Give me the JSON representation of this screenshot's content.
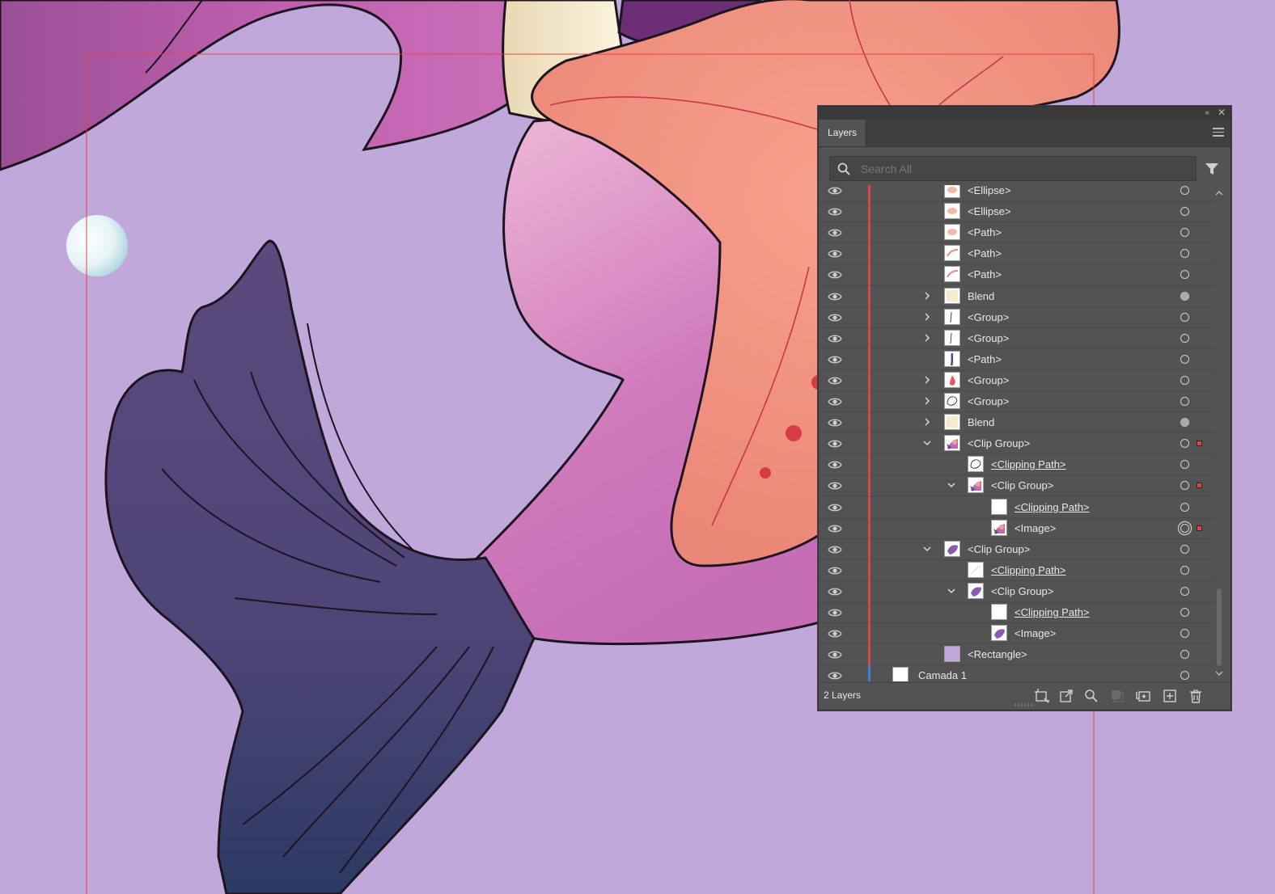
{
  "panel": {
    "title": "Layers",
    "collapse_glyph": "«",
    "close_glyph": "✕",
    "search_placeholder": "Search All",
    "layer_count": "2 Layers"
  },
  "colors": {
    "canvas_background": "#c0a9da",
    "panel_background": "#535353",
    "layer_color_red": "#e0424a",
    "layer_color_blue": "#3f7fe0"
  },
  "rows": [
    {
      "name": "<Ellipse>",
      "depth": 2,
      "chevron": "none",
      "thumb": "ellipse",
      "target": "empty",
      "selected": false,
      "bar": "red",
      "clip": false
    },
    {
      "name": "<Ellipse>",
      "depth": 2,
      "chevron": "none",
      "thumb": "ellipse",
      "target": "empty",
      "selected": false,
      "bar": "red",
      "clip": false
    },
    {
      "name": "<Path>",
      "depth": 2,
      "chevron": "none",
      "thumb": "ellipse",
      "target": "empty",
      "selected": false,
      "bar": "red",
      "clip": false
    },
    {
      "name": "<Path>",
      "depth": 2,
      "chevron": "none",
      "thumb": "stroke",
      "target": "empty",
      "selected": false,
      "bar": "red",
      "clip": false
    },
    {
      "name": "<Path>",
      "depth": 2,
      "chevron": "none",
      "thumb": "stroke",
      "target": "empty",
      "selected": false,
      "bar": "red",
      "clip": false
    },
    {
      "name": "Blend",
      "depth": 2,
      "chevron": "right",
      "thumb": "cream",
      "target": "filled",
      "selected": false,
      "bar": "red",
      "clip": false
    },
    {
      "name": "<Group>",
      "depth": 2,
      "chevron": "right",
      "thumb": "line",
      "target": "empty",
      "selected": false,
      "bar": "red",
      "clip": false
    },
    {
      "name": "<Group>",
      "depth": 2,
      "chevron": "right",
      "thumb": "line",
      "target": "empty",
      "selected": false,
      "bar": "red",
      "clip": false
    },
    {
      "name": "<Path>",
      "depth": 2,
      "chevron": "none",
      "thumb": "purple-line",
      "target": "empty",
      "selected": false,
      "bar": "red",
      "clip": false
    },
    {
      "name": "<Group>",
      "depth": 2,
      "chevron": "right",
      "thumb": "drop",
      "target": "empty",
      "selected": false,
      "bar": "red",
      "clip": false
    },
    {
      "name": "<Group>",
      "depth": 2,
      "chevron": "right",
      "thumb": "outline",
      "target": "empty",
      "selected": false,
      "bar": "red",
      "clip": false
    },
    {
      "name": "Blend",
      "depth": 2,
      "chevron": "right",
      "thumb": "cream",
      "target": "filled",
      "selected": false,
      "bar": "red",
      "clip": false
    },
    {
      "name": "<Clip Group>",
      "depth": 2,
      "chevron": "down",
      "thumb": "art",
      "target": "empty",
      "selected": true,
      "bar": "red",
      "clip": false
    },
    {
      "name": "<Clipping Path>",
      "depth": 3,
      "chevron": "none",
      "thumb": "outline",
      "target": "empty",
      "selected": false,
      "bar": "red",
      "clip": true
    },
    {
      "name": "<Clip Group>",
      "depth": 3,
      "chevron": "down",
      "thumb": "art",
      "target": "empty",
      "selected": true,
      "bar": "red",
      "clip": false
    },
    {
      "name": "<Clipping Path>",
      "depth": 4,
      "chevron": "none",
      "thumb": "blank",
      "target": "empty",
      "selected": false,
      "bar": "red",
      "clip": true
    },
    {
      "name": "<Image>",
      "depth": 4,
      "chevron": "none",
      "thumb": "art",
      "target": "double",
      "selected": true,
      "bar": "red",
      "clip": false
    },
    {
      "name": "<Clip Group>",
      "depth": 2,
      "chevron": "down",
      "thumb": "tail",
      "target": "empty",
      "selected": false,
      "bar": "red",
      "clip": false
    },
    {
      "name": "<Clipping Path>",
      "depth": 3,
      "chevron": "none",
      "thumb": "blank-line",
      "target": "empty",
      "selected": false,
      "bar": "red",
      "clip": true
    },
    {
      "name": "<Clip Group>",
      "depth": 3,
      "chevron": "down",
      "thumb": "tail",
      "target": "empty",
      "selected": false,
      "bar": "red",
      "clip": false
    },
    {
      "name": "<Clipping Path>",
      "depth": 4,
      "chevron": "none",
      "thumb": "blank",
      "target": "empty",
      "selected": false,
      "bar": "red",
      "clip": true
    },
    {
      "name": "<Image>",
      "depth": 4,
      "chevron": "none",
      "thumb": "tail",
      "target": "empty",
      "selected": false,
      "bar": "red",
      "clip": false
    },
    {
      "name": "<Rectangle>",
      "depth": 2,
      "chevron": "none",
      "thumb": "lavender",
      "target": "empty",
      "selected": false,
      "bar": "red",
      "clip": false
    },
    {
      "name": "Camada 1",
      "depth": 0,
      "chevron": "none",
      "thumb": "blank",
      "target": "empty",
      "selected": false,
      "bar": "blue",
      "clip": false
    }
  ],
  "footer_icons": [
    "collect-for-export-icon",
    "release-to-layers-icon",
    "locate-object-icon",
    "make-clipping-mask-icon",
    "create-sublayer-icon",
    "create-new-layer-icon",
    "delete-layer-icon"
  ]
}
